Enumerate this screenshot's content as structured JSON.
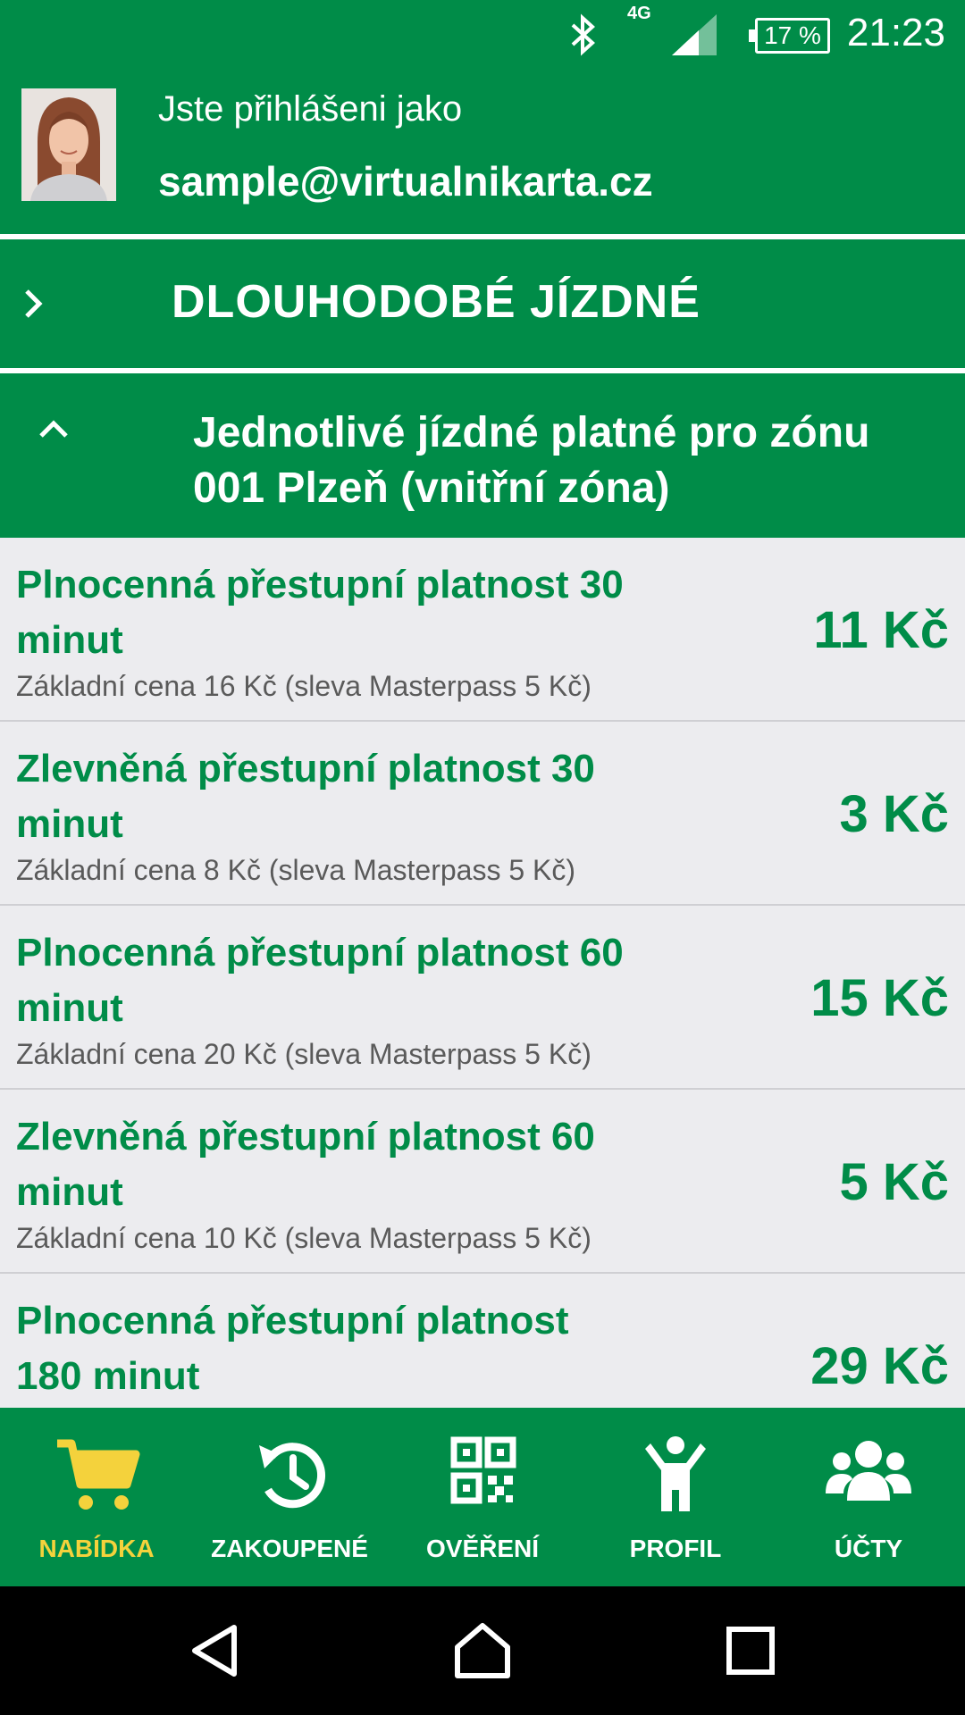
{
  "status_bar": {
    "time": "21:23",
    "battery": "17 %",
    "network": "4G",
    "icons": [
      "bluetooth-icon",
      "signal-icon",
      "battery-icon"
    ]
  },
  "header": {
    "label": "Jste přihlášeni jako",
    "email": "sample@virtualnikarta.cz"
  },
  "sections": {
    "long_term": {
      "title": "DLOUHODOBÉ JÍZDNÉ",
      "expanded": false
    },
    "single": {
      "title": "Jednotlivé jízdné platné pro zónu 001 Plzeň (vnitřní zóna)",
      "expanded": true
    }
  },
  "tickets": [
    {
      "name": "Plnocenná přestupní platnost 30 minut",
      "sub": "Základní cena 16 Kč (sleva Masterpass 5 Kč)",
      "price": "11 Kč"
    },
    {
      "name": "Zlevněná přestupní platnost 30 minut",
      "sub": "Základní cena 8 Kč (sleva Masterpass 5 Kč)",
      "price": "3 Kč"
    },
    {
      "name": "Plnocenná přestupní platnost 60 minut",
      "sub": "Základní cena 20 Kč (sleva Masterpass 5 Kč)",
      "price": "15 Kč"
    },
    {
      "name": "Zlevněná přestupní platnost 60 minut",
      "sub": "Základní cena 10 Kč (sleva Masterpass 5 Kč)",
      "price": "5 Kč"
    },
    {
      "name": "Plnocenná přestupní platnost 180 minut",
      "sub": "",
      "price": "29 Kč"
    }
  ],
  "bottom_nav": [
    {
      "label": "NABÍDKA",
      "icon": "cart-icon",
      "active": true
    },
    {
      "label": "ZAKOUPENÉ",
      "icon": "history-icon",
      "active": false
    },
    {
      "label": "OVĚŘENÍ",
      "icon": "qr-code-icon",
      "active": false
    },
    {
      "label": "PROFIL",
      "icon": "person-icon",
      "active": false
    },
    {
      "label": "ÚČTY",
      "icon": "group-icon",
      "active": false
    }
  ],
  "colors": {
    "brand_green": "#008c48",
    "active_yellow": "#f4d23c",
    "list_background": "#ececef"
  }
}
